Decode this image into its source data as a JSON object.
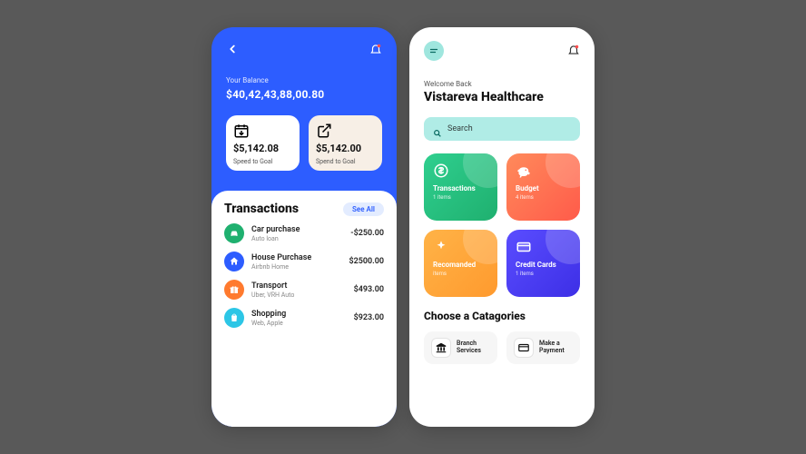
{
  "phoneA": {
    "balance_label": "Your Balance",
    "balance_amount": "$40,42,43,88,00.80",
    "cards": [
      {
        "amount": "$5,142.08",
        "label": "Speed to Goal"
      },
      {
        "amount": "$5,142.00",
        "label": "Spend to Goal"
      }
    ],
    "panel_title": "Transactions",
    "see_all": "See All",
    "transactions": [
      {
        "title": "Car purchase",
        "sub": "Auto loan",
        "amount": "-$250.00",
        "color": "#1fb06f"
      },
      {
        "title": "House Purchase",
        "sub": "Airbnb Home",
        "amount": "$2500.00",
        "color": "#2d5dff"
      },
      {
        "title": "Transport",
        "sub": "Uber, VRH Auto",
        "amount": "$493.00",
        "color": "#ff7a2e"
      },
      {
        "title": "Shopping",
        "sub": "Web, Apple",
        "amount": "$923.00",
        "color": "#2cc6e6"
      }
    ]
  },
  "phoneB": {
    "welcome_small": "Welcome Back",
    "welcome_title": "Vistareva Healthcare",
    "search_placeholder": "Search",
    "tiles": [
      {
        "title": "Transactions",
        "sub": "1 items"
      },
      {
        "title": "Budget",
        "sub": "4 items"
      },
      {
        "title": "Recomanded",
        "sub": "items"
      },
      {
        "title": "Credit Cards",
        "sub": "1 items"
      }
    ],
    "categories_title": "Choose a Catagories",
    "categories": [
      {
        "line1": "Branch",
        "line2": "Services"
      },
      {
        "line1": "Make a",
        "line2": "Payment"
      }
    ]
  }
}
